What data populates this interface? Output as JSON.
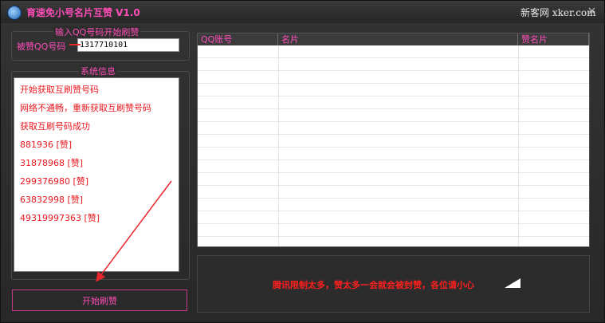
{
  "window": {
    "title": "育速免小号名片互赞 V1.0",
    "watermark": "新客网 xker.com",
    "close_symbol": "×"
  },
  "input_group": {
    "legend": "输入QQ号码开始刷赞",
    "label": "被赞QQ号码",
    "value": "1317710101"
  },
  "system_info": {
    "legend": "系统信息",
    "lines": [
      "开始获取互刷赞号码",
      "网络不通畅，重新获取互刷赞号码",
      "获取互刷号码成功",
      "881936 [赞]",
      "31878968 [赞]",
      "299376980 [赞]",
      "63832998 [赞]",
      "49319997363 [赞]"
    ]
  },
  "start_button": {
    "label": "开始刷赞"
  },
  "table": {
    "columns": [
      "QQ账号",
      "名片",
      "赞名片"
    ]
  },
  "notice": {
    "text": "腾讯限制太多，赞太多一会就会被封赞，各位请小心"
  },
  "colors": {
    "accent": "#ff4db8",
    "log_text": "#e8181f",
    "notice_text": "#ff1f1f",
    "arrow": "#e8262e"
  }
}
